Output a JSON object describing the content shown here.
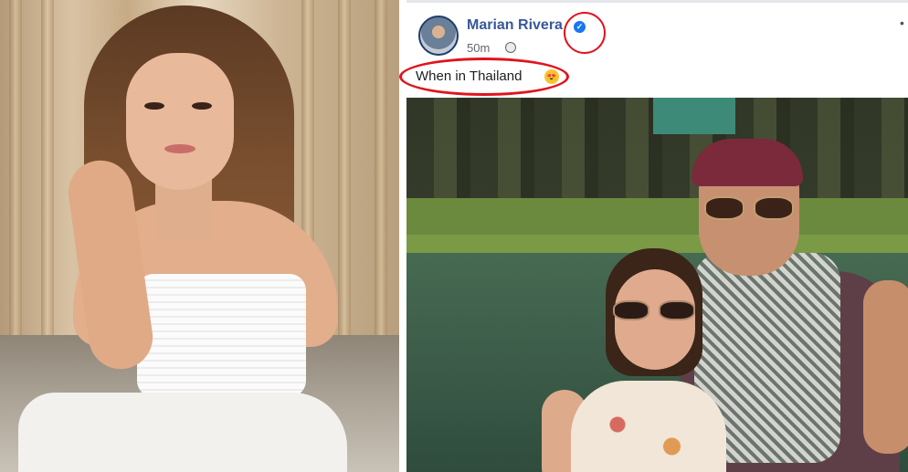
{
  "post": {
    "author": "Marian Rivera",
    "time": "50m",
    "caption": "When in Thailand",
    "more": "•",
    "verified_mark": "✓",
    "emoji": "😍"
  },
  "icons": [
    "verified-badge-icon",
    "globe-icon",
    "more-options-icon",
    "heart-eyes-emoji-icon"
  ],
  "colors": {
    "author_link": "#385898",
    "verified": "#1877f2",
    "annotation_circle": "#e0141e",
    "timestamp": "#616770"
  }
}
